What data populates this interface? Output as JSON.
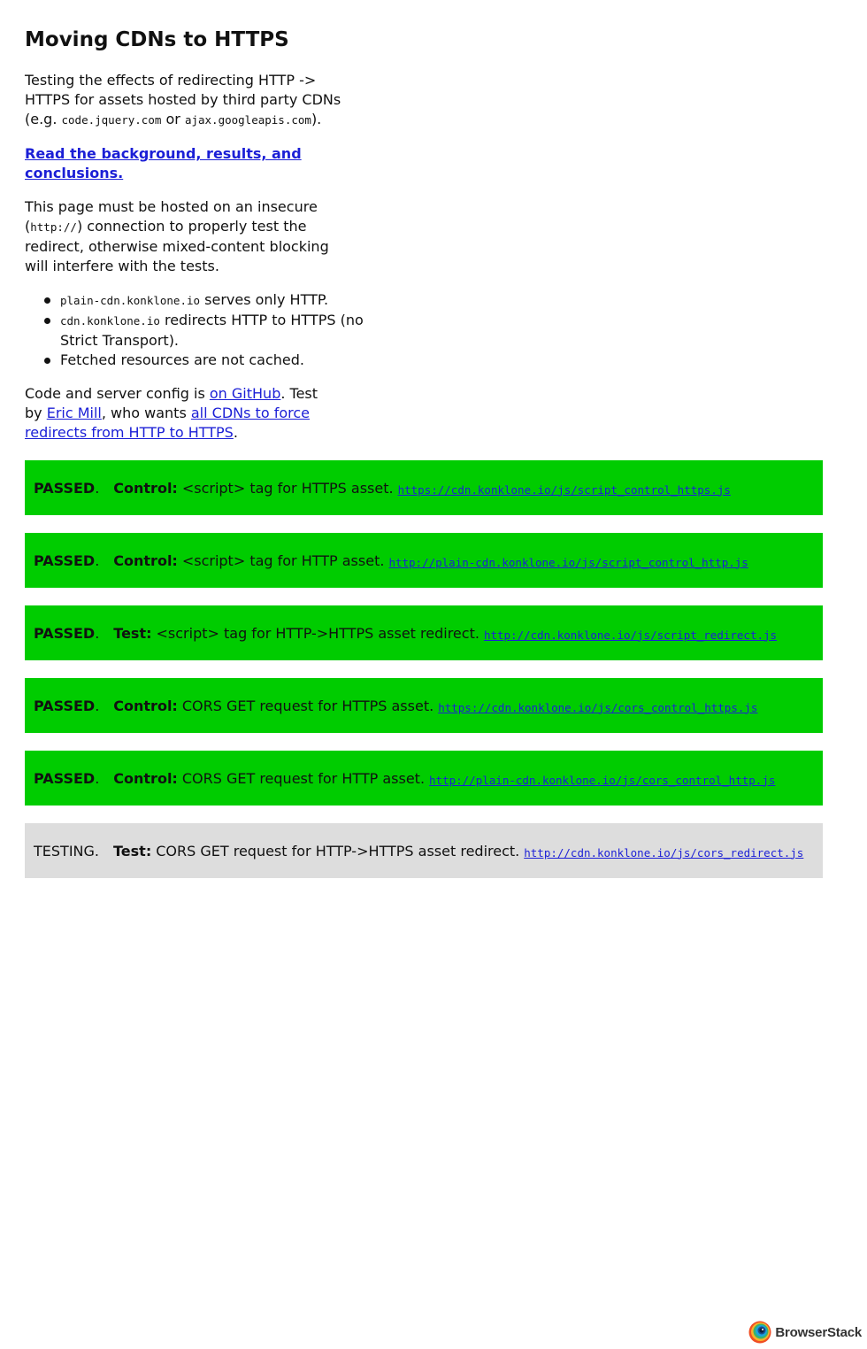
{
  "page": {
    "title": "Moving CDNs to HTTPS",
    "intro": {
      "before": "Testing the effects of redirecting HTTP -> HTTPS for assets hosted by third party CDNs (e.g. ",
      "code1": "code.jquery.com",
      "middle": " or ",
      "code2": "ajax.googleapis.com",
      "after": ")."
    },
    "background_link": "Read the background, results, and conclusions.",
    "insecure_note": {
      "before": "This page must be hosted on an insecure (",
      "code": "http://",
      "after": ") connection to properly test the redirect, otherwise mixed-content blocking will interfere with the tests."
    },
    "bullets": [
      {
        "code": "plain-cdn.konklone.io",
        "text": " serves only HTTP."
      },
      {
        "code": "cdn.konklone.io",
        "text": " redirects HTTP to HTTPS (no Strict Transport)."
      },
      {
        "code": "",
        "text": "Fetched resources are not cached."
      }
    ],
    "credits": {
      "text1": "Code and server config is ",
      "link1": "on GitHub",
      "text2": ". Test by ",
      "link2": "Eric Mill",
      "text3": ", who wants ",
      "link3": "all CDNs to force redirects from HTTP to HTTPS",
      "text4": "."
    }
  },
  "tests": [
    {
      "status": "PASSED",
      "kind": "Control:",
      "desc": "<script> tag for HTTPS asset.",
      "url": "https://cdn.konklone.io/js/script_control_https.js"
    },
    {
      "status": "PASSED",
      "kind": "Control:",
      "desc": "<script> tag for HTTP asset.",
      "url": "http://plain-cdn.konklone.io/js/script_control_http.js"
    },
    {
      "status": "PASSED",
      "kind": "Test:",
      "desc": "<script> tag for HTTP->HTTPS asset redirect.",
      "url": "http://cdn.konklone.io/js/script_redirect.js"
    },
    {
      "status": "PASSED",
      "kind": "Control:",
      "desc": "CORS GET request for HTTPS asset.",
      "url": "https://cdn.konklone.io/js/cors_control_https.js"
    },
    {
      "status": "PASSED",
      "kind": "Control:",
      "desc": "CORS GET request for HTTP asset.",
      "url": "http://plain-cdn.konklone.io/js/cors_control_http.js"
    },
    {
      "status": "TESTING",
      "kind": "Test:",
      "desc": "CORS GET request for HTTP->HTTPS asset redirect.",
      "url": "http://cdn.konklone.io/js/cors_redirect.js"
    }
  ],
  "colors": {
    "passed": "#00cc00",
    "testing": "#dddddd",
    "link": "#1b1fd6"
  },
  "badge": {
    "text": "BrowserStack",
    "icon": "browserstack-logo-icon"
  }
}
